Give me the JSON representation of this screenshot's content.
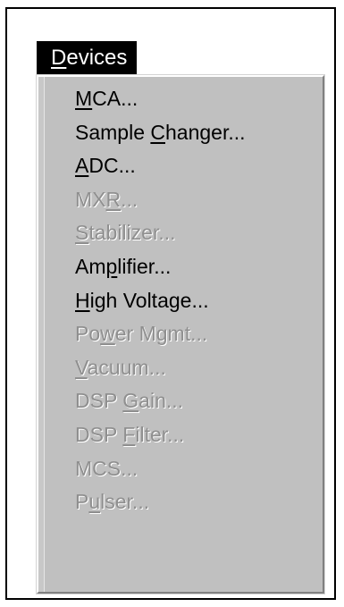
{
  "menubar": {
    "title": "Devices",
    "mnemonic_index": 0
  },
  "menu": {
    "items": [
      {
        "label": "MCA...",
        "enabled": true,
        "mnemonic": 0
      },
      {
        "label": "Sample Changer...",
        "enabled": true,
        "mnemonic": 7
      },
      {
        "label": "ADC...",
        "enabled": true,
        "mnemonic": 0
      },
      {
        "label": "MXR...",
        "enabled": false,
        "mnemonic": 2
      },
      {
        "label": "Stabilizer...",
        "enabled": false,
        "mnemonic": 0
      },
      {
        "label": "Amplifier...",
        "enabled": true,
        "mnemonic": 2
      },
      {
        "label": "High Voltage...",
        "enabled": true,
        "mnemonic": 0
      },
      {
        "label": "Power Mgmt...",
        "enabled": false,
        "mnemonic": 2
      },
      {
        "label": "Vacuum...",
        "enabled": false,
        "mnemonic": 0
      },
      {
        "label": "DSP Gain...",
        "enabled": false,
        "mnemonic": 4
      },
      {
        "label": "DSP Filter...",
        "enabled": false,
        "mnemonic": 4
      },
      {
        "label": "MCS...",
        "enabled": false,
        "mnemonic": -1
      },
      {
        "label": "Pulser...",
        "enabled": false,
        "mnemonic": 1
      }
    ]
  },
  "colors": {
    "menu_background": "#c0c0c0",
    "enabled_text": "#000000",
    "disabled_text": "#8f8f8f",
    "highlight_background": "#000000",
    "highlight_text": "#ffffff"
  }
}
